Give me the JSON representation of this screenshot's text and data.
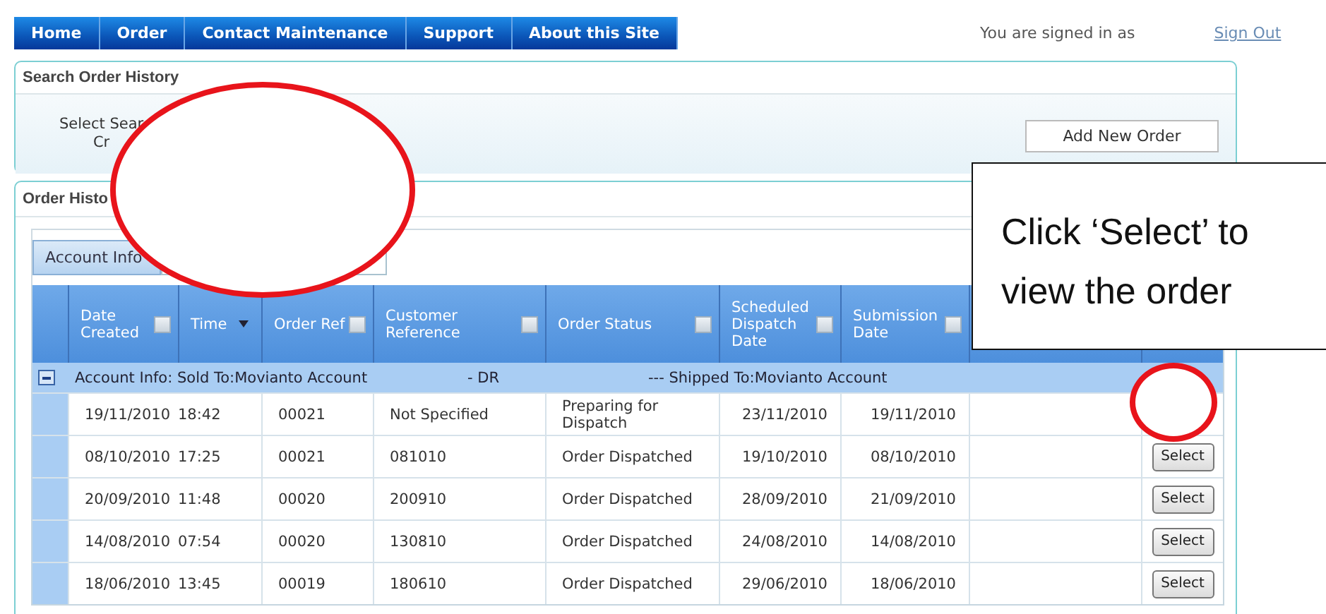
{
  "nav": {
    "tabs": [
      {
        "label": "Home"
      },
      {
        "label": "Order"
      },
      {
        "label": "Contact Maintenance"
      },
      {
        "label": "Support"
      },
      {
        "label": "About this Site"
      }
    ],
    "signed_in": "You are signed in as",
    "sign_out": "Sign Out"
  },
  "search_panel": {
    "title": "Search Order History",
    "label_lines": [
      "Select Sear",
      "Cr"
    ],
    "add_button": "Add New Order"
  },
  "history_panel": {
    "title": "Order Histo",
    "group_button": "Account Info",
    "columns": [
      {
        "label": "Date Created",
        "kind": "filter"
      },
      {
        "label": "Time",
        "kind": "sort"
      },
      {
        "label": "Order Ref",
        "kind": "filter"
      },
      {
        "label": "Customer Reference",
        "kind": "filter"
      },
      {
        "label": "Order Status",
        "kind": "filter"
      },
      {
        "label": "Scheduled Dispatch Date",
        "kind": "filter"
      },
      {
        "label": "Submission Date",
        "kind": "filter"
      }
    ],
    "group": {
      "expanded": true,
      "texts": [
        "Account Info: Sold To:Movianto Account",
        "- DR",
        "--- Shipped To:Movianto Account"
      ]
    },
    "rows": [
      {
        "date": "19/11/2010",
        "time": "18:42",
        "ref": "00021",
        "customer_ref": "Not Specified",
        "status": "Preparing for Dispatch",
        "dispatch": "23/11/2010",
        "submitted": "19/11/2010"
      },
      {
        "date": "08/10/2010",
        "time": "17:25",
        "ref": "00021",
        "customer_ref": "081010",
        "status": "Order Dispatched",
        "dispatch": "19/10/2010",
        "submitted": "08/10/2010",
        "action": "Select"
      },
      {
        "date": "20/09/2010",
        "time": "11:48",
        "ref": "00020",
        "customer_ref": "200910",
        "status": "Order Dispatched",
        "dispatch": "28/09/2010",
        "submitted": "21/09/2010",
        "action": "Select"
      },
      {
        "date": "14/08/2010",
        "time": "07:54",
        "ref": "00020",
        "customer_ref": "130810",
        "status": "Order Dispatched",
        "dispatch": "24/08/2010",
        "submitted": "14/08/2010",
        "action": "Select"
      },
      {
        "date": "18/06/2010",
        "time": "13:45",
        "ref": "00019",
        "customer_ref": "180610",
        "status": "Order Dispatched",
        "dispatch": "29/06/2010",
        "submitted": "18/06/2010",
        "action": "Select"
      }
    ]
  },
  "callout": {
    "text": "Click ‘Select’ to view the order"
  }
}
